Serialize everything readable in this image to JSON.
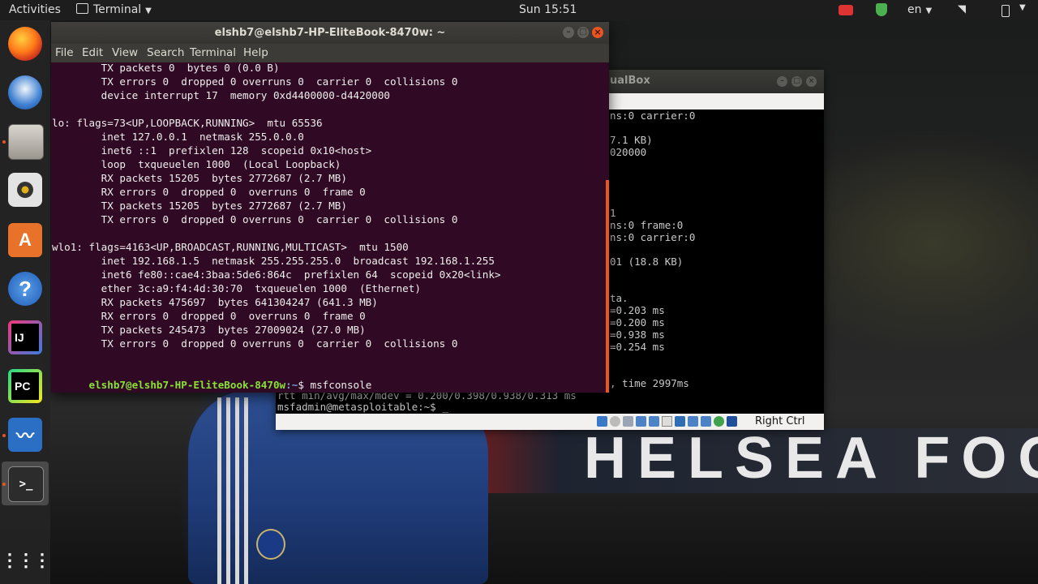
{
  "topbar": {
    "activities": "Activities",
    "app_menu": "Terminal",
    "clock": "Sun 15:51",
    "language": "en"
  },
  "dock": {
    "apps": [
      "Firefox",
      "Thunderbird",
      "Files",
      "Rhythmbox",
      "Ubuntu Software",
      "Help",
      "IntelliJ IDEA",
      "PyCharm",
      "System Monitor",
      "Terminal",
      "Show Applications"
    ],
    "labels": {
      "intellij": "IJ",
      "pycharm": "PC"
    }
  },
  "terminal": {
    "title": "elshb7@elshb7-HP-EliteBook-8470w: ~",
    "menu": [
      "File",
      "Edit",
      "View",
      "Search",
      "Terminal",
      "Help"
    ],
    "lines": [
      "        TX packets 0  bytes 0 (0.0 B)",
      "        TX errors 0  dropped 0 overruns 0  carrier 0  collisions 0",
      "        device interrupt 17  memory 0xd4400000-d4420000",
      "",
      "lo: flags=73<UP,LOOPBACK,RUNNING>  mtu 65536",
      "        inet 127.0.0.1  netmask 255.0.0.0",
      "        inet6 ::1  prefixlen 128  scopeid 0x10<host>",
      "        loop  txqueuelen 1000  (Local Loopback)",
      "        RX packets 15205  bytes 2772687 (2.7 MB)",
      "        RX errors 0  dropped 0  overruns 0  frame 0",
      "        TX packets 15205  bytes 2772687 (2.7 MB)",
      "        TX errors 0  dropped 0 overruns 0  carrier 0  collisions 0",
      "",
      "wlo1: flags=4163<UP,BROADCAST,RUNNING,MULTICAST>  mtu 1500",
      "        inet 192.168.1.5  netmask 255.255.255.0  broadcast 192.168.1.255",
      "        inet6 fe80::cae4:3baa:5de6:864c  prefixlen 64  scopeid 0x20<link>",
      "        ether 3c:a9:f4:4d:30:70  txqueuelen 1000  (Ethernet)",
      "        RX packets 475697  bytes 641304247 (641.3 MB)",
      "        RX errors 0  dropped 0  overruns 0  frame 0",
      "        TX packets 245473  bytes 27009024 (27.0 MB)",
      "        TX errors 0  dropped 0 overruns 0  carrier 0  collisions 0",
      ""
    ],
    "prompt_user": "elshb7@elshb7-HP-EliteBook-8470w",
    "prompt_path": ":~",
    "prompt_symbol": "$ ",
    "command": "msfconsole"
  },
  "virtualbox": {
    "title_fragment": "ualBox",
    "status_label": "Right Ctrl",
    "visible_lines": [
      "ns:0 carrier:0",
      "",
      "7.1 KB)",
      "020000",
      "",
      "",
      "",
      "",
      "1",
      "ns:0 frame:0",
      "ns:0 carrier:0",
      "",
      "01 (18.8 KB)",
      "",
      "",
      "ta.",
      "=0.203 ms",
      "=0.200 ms",
      "=0.938 ms",
      "=0.254 ms",
      "",
      "",
      ", time 2997ms"
    ],
    "rtt_line": "rtt min/avg/max/mdev = 0.200/0.398/0.938/0.313 ms",
    "prompt_line": "msfadmin@metasploitable:~$ _"
  },
  "wallpaper": {
    "banner_text": "HELSEA FOO"
  },
  "colors": {
    "terminal_bg": "#300a24",
    "prompt_user": "#8ae234",
    "prompt_path": "#729fcf",
    "ubuntu_orange": "#e95420"
  }
}
